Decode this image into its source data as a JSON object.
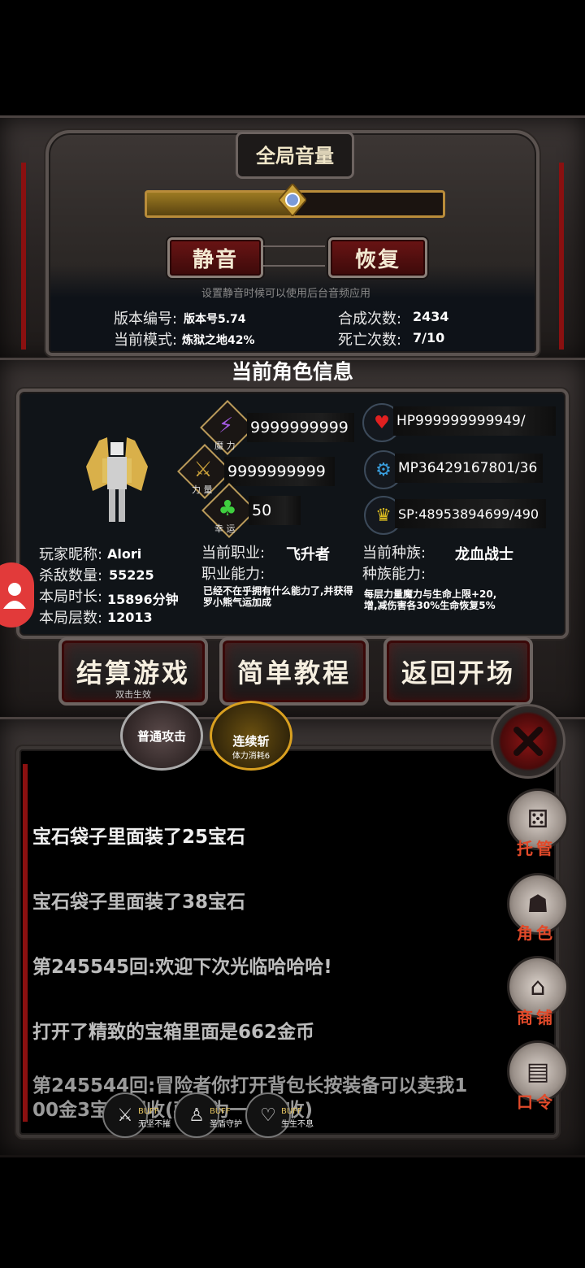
{
  "volume_panel": {
    "title": "全局音量",
    "volume_level": 0.5,
    "mute_label": "静音",
    "restore_label": "恢复",
    "hint": "设置静音时候可以使用后台音频应用"
  },
  "game_info": {
    "version_label": "版本编号:",
    "version_value": "版本号5.74",
    "merge_label": "合成次数:",
    "merge_value": "2434",
    "mode_label": "当前模式:",
    "mode_value": "炼狱之地42%",
    "death_label": "死亡次数:",
    "death_value": "7/10"
  },
  "character": {
    "section_title": "当前角色信息",
    "magic": {
      "label": "魔 力",
      "value": "9999999999"
    },
    "strength": {
      "label": "力 量",
      "value": "9999999999"
    },
    "luck": {
      "label": "幸 运",
      "value": "50"
    },
    "hp": {
      "prefix": "HP",
      "value": "999999999949/"
    },
    "mp": {
      "prefix": "MP",
      "value": "36429167801/36"
    },
    "sp": {
      "prefix": "SP:",
      "value": "48953894699/490"
    },
    "nickname_label": "玩家昵称:",
    "nickname": "Alori",
    "kills_label": "杀敌数量:",
    "kills": "55225",
    "time_label": "本局时长:",
    "time": "15896分钟",
    "floors_label": "本局层数:",
    "floors": "12013",
    "job_label": "当前职业:",
    "job": "飞升者",
    "job_ability_label": "职业能力:",
    "job_ability": "已经不在乎拥有什么能力了,并获得罗小熊气运加成",
    "race_label": "当前种族:",
    "race": "龙血战士",
    "race_ability_label": "种族能力:",
    "race_ability": "每层力量魔力与生命上限+20,增,减伤害各30%生命恢复5%"
  },
  "actions": {
    "settle_label": "结算游戏",
    "settle_hint": "双击生效",
    "tutorial_label": "简单教程",
    "return_label": "返回开场"
  },
  "skills": {
    "normal_attack": "普通攻击",
    "combo_slash": "连续斩",
    "combo_cost": "体力消耗6"
  },
  "log": [
    "宝石袋子里面装了25宝石",
    "宝石袋子里面装了38宝石",
    "第245545回:欢迎下次光临哈哈哈!",
    "打开了精致的宝箱里面是662金币",
    "第245544回:冒险者你打开背包长按装备可以卖我1",
    "00金3宝石回收(藏品为一组回收)"
  ],
  "side_menu": {
    "auto": "托管",
    "role": "角色",
    "shop": "商铺",
    "code": "口令"
  },
  "buffs": [
    {
      "tag": "BUFF",
      "name": "无坚不摧"
    },
    {
      "tag": "BUFF",
      "name": "圣盾守护"
    },
    {
      "tag": "BUFF",
      "name": "生生不息"
    }
  ],
  "colors": {
    "accent_red": "#8a1010",
    "gold": "#c9a03a",
    "label_orange": "#e24a2a"
  }
}
